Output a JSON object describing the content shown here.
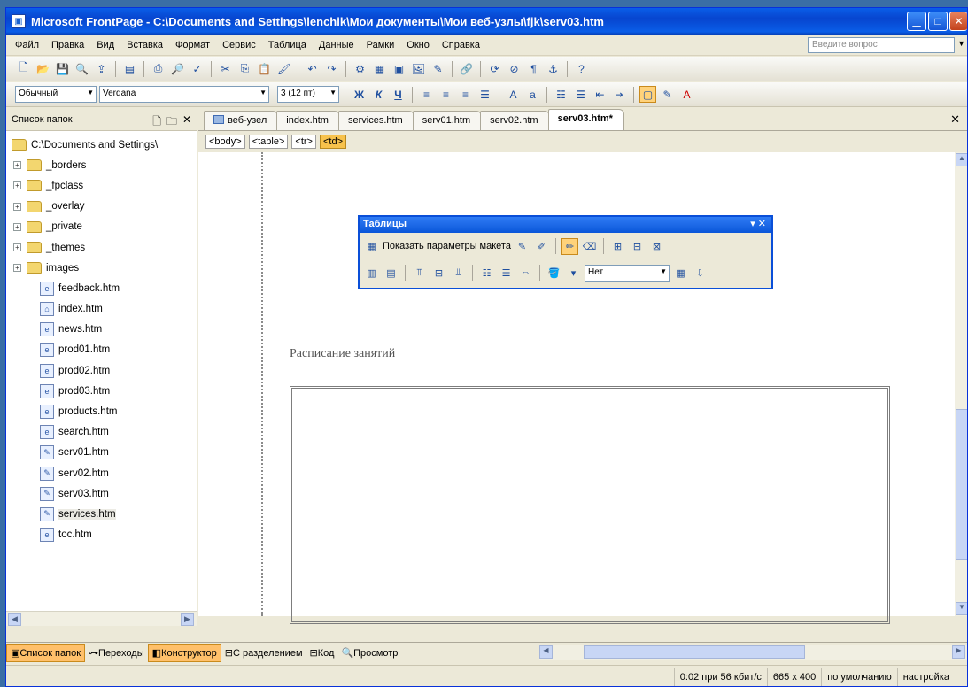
{
  "window": {
    "title": "Microsoft FrontPage - C:\\Documents and Settings\\lenchik\\Мои документы\\Мои веб-узлы\\fjk\\serv03.htm"
  },
  "menu": {
    "items": [
      "Файл",
      "Правка",
      "Вид",
      "Вставка",
      "Формат",
      "Сервис",
      "Таблица",
      "Данные",
      "Рамки",
      "Окно",
      "Справка"
    ],
    "ask_placeholder": "Введите вопрос"
  },
  "formatting": {
    "style": "Обычный",
    "font": "Verdana",
    "size": "3 (12 пт)",
    "bold": "Ж",
    "italic": "К",
    "underline": "Ч"
  },
  "folder_panel": {
    "title": "Список папок",
    "root": "C:\\Documents and Settings\\",
    "folders": [
      "_borders",
      "_fpclass",
      "_overlay",
      "_private",
      "_themes",
      "images"
    ],
    "files": [
      "feedback.htm",
      "index.htm",
      "news.htm",
      "prod01.htm",
      "prod02.htm",
      "prod03.htm",
      "products.htm",
      "search.htm",
      "serv01.htm",
      "serv02.htm",
      "serv03.htm",
      "services.htm",
      "toc.htm"
    ]
  },
  "doc_tabs": [
    "веб-узел",
    "index.htm",
    "services.htm",
    "serv01.htm",
    "serv02.htm",
    "serv03.htm*"
  ],
  "tag_path": [
    "<body>",
    "<table>",
    "<tr>",
    "<td>"
  ],
  "tables_toolbar": {
    "title": "Таблицы",
    "show_layout": "Показать параметры макета",
    "fill_value": "Нет"
  },
  "document": {
    "heading": "Расписание занятий"
  },
  "view_tabs": {
    "folder_list": "Список папок",
    "navigation": "Переходы",
    "design": "Конструктор",
    "split": "С разделением",
    "code": "Код",
    "preview": "Просмотр"
  },
  "status": {
    "speed": "0:02 при 56 кбит/с",
    "size": "665 x 400",
    "mode": "по умолчанию",
    "settings": "настройка"
  }
}
